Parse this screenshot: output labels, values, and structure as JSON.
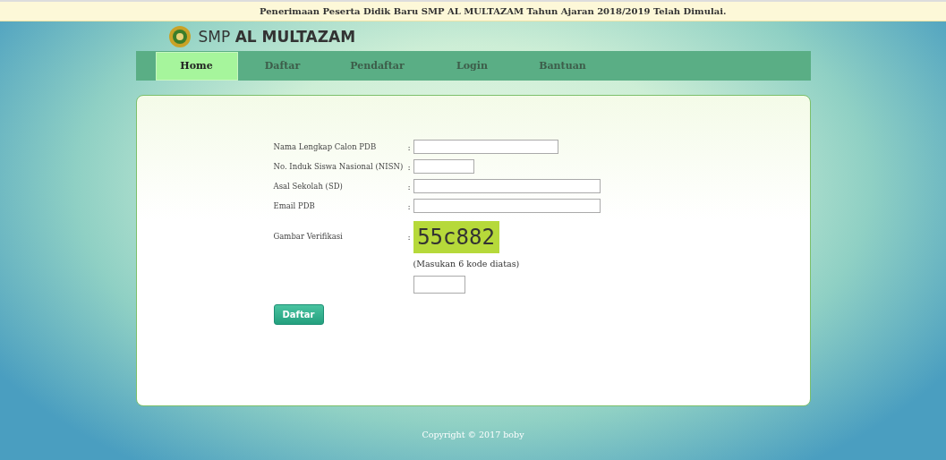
{
  "announcement": "Penerimaan Peserta Didik Baru SMP AL MULTAZAM Tahun Ajaran 2018/2019 Telah Dimulai.",
  "header": {
    "prefix": "SMP",
    "name": "AL MULTAZAM"
  },
  "nav": [
    {
      "label": "Home",
      "selected": true
    },
    {
      "label": "Daftar",
      "selected": false
    },
    {
      "label": "Pendaftar",
      "selected": false
    },
    {
      "label": "Login",
      "selected": false
    },
    {
      "label": "Bantuan",
      "selected": false
    }
  ],
  "form": {
    "fields": [
      {
        "kind": "text",
        "label": "Nama Lengkap Calon PDB",
        "separator": ":"
      },
      {
        "kind": "text",
        "label": "No. Induk Siswa Nasional (NISN)",
        "separator": ":"
      },
      {
        "kind": "text",
        "label": "Asal Sekolah (SD)",
        "separator": ":"
      },
      {
        "kind": "text",
        "label": "Email PDB",
        "separator": ":"
      },
      {
        "kind": "captcha",
        "label": "Gambar Verifikasi",
        "separator": ":",
        "captcha": "55c882",
        "hint": "(Masukan 6 kode diatas)"
      }
    ],
    "submit": "Daftar"
  },
  "footer": "Copyright © 2017 boby"
}
